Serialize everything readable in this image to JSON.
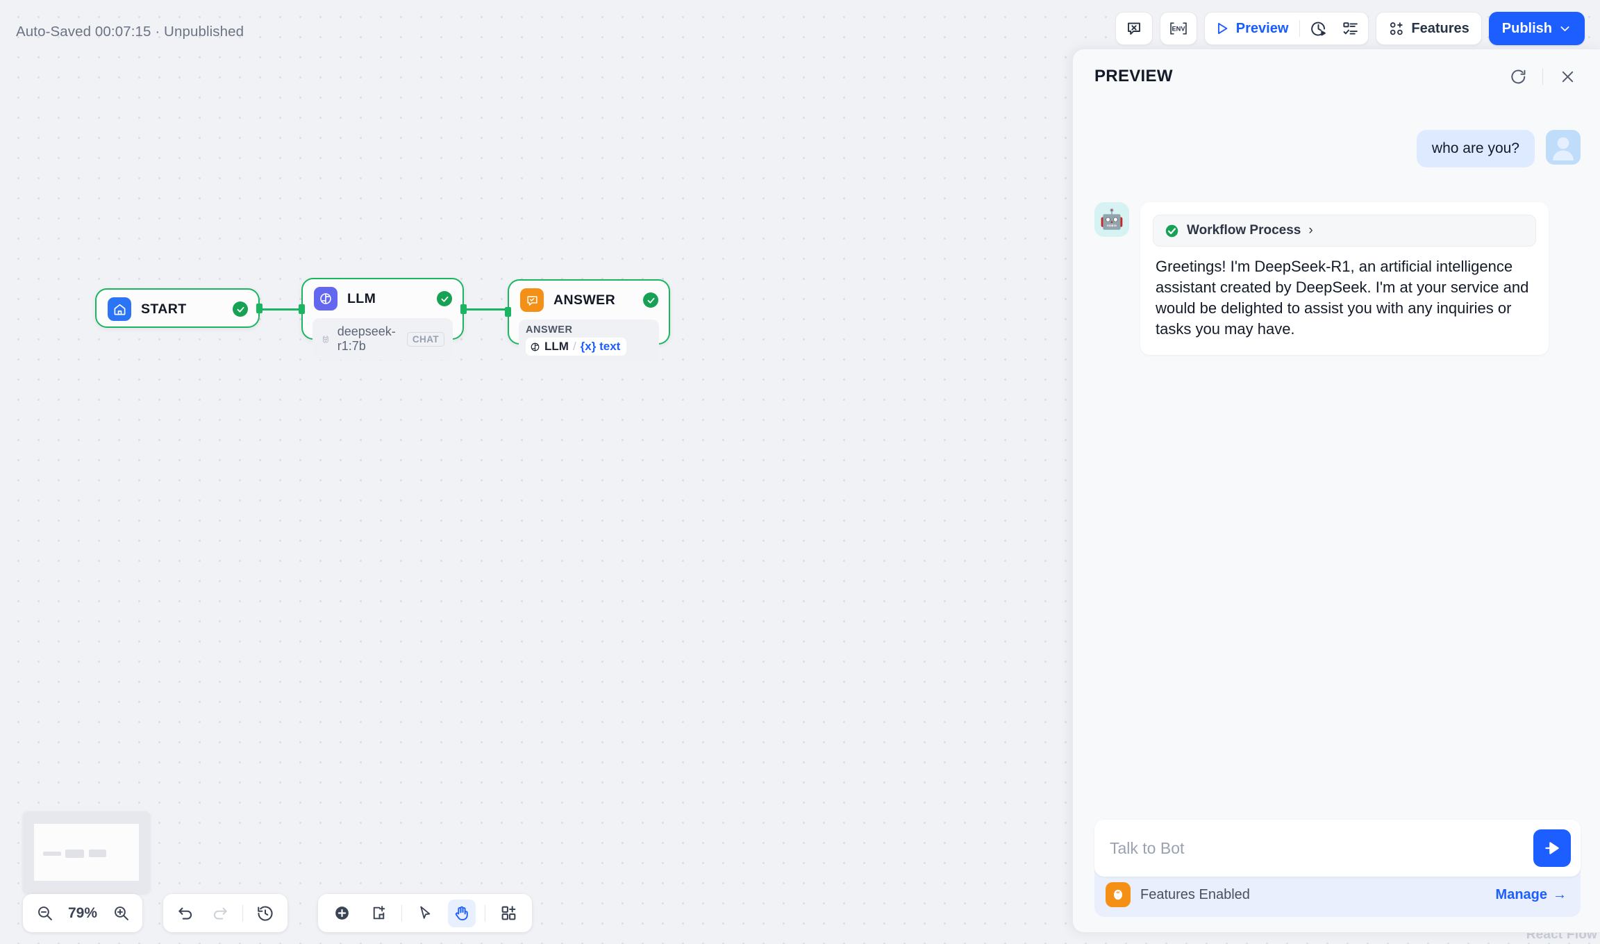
{
  "topbar": {
    "autosave_status": "Auto-Saved 00:07:15 · Unpublished",
    "icon_chat_x": "chat-variable-icon",
    "icon_env": "ENV",
    "preview_label": "Preview",
    "icon_history": "run-history-icon",
    "icon_checklist": "checklist-icon",
    "features_label": "Features",
    "publish_label": "Publish",
    "publish_caret": "⌄",
    "publish_color": "#1c5eff"
  },
  "canvas": {
    "nodes": [
      {
        "id": "start",
        "title": "START",
        "icon": "home-icon",
        "icon_color": "#2b74f5",
        "status": "success"
      },
      {
        "id": "llm",
        "title": "LLM",
        "icon": "llm-icon",
        "icon_color": "#6366ee",
        "status": "success",
        "model": "deepseek-r1:7b",
        "model_icon": "ollama-llama-icon",
        "model_tag": "CHAT"
      },
      {
        "id": "answer",
        "title": "ANSWER",
        "icon": "answer-icon",
        "icon_color": "#f59017",
        "status": "success",
        "output_label": "ANSWER",
        "variable_source": "LLM",
        "variable_sep": "/",
        "variable_name": "{x} text"
      }
    ],
    "edge_color": "#1bb561",
    "watermark": "React Flow"
  },
  "controls": {
    "zoom_out_icon": "zoom-out-icon",
    "zoom_level": "79%",
    "zoom_in_icon": "zoom-in-icon",
    "undo_icon": "undo-icon",
    "redo_icon": "redo-icon",
    "history_icon": "version-history-icon",
    "add_node_icon": "add-node-icon",
    "add_note_icon": "add-note-icon",
    "pointer_icon": "pointer-icon",
    "hand_icon": "hand-tool-icon",
    "organize_icon": "add-block-icon",
    "active_tool": "hand"
  },
  "panel": {
    "title": "PREVIEW",
    "restart_icon": "restart-icon",
    "close_icon": "close-icon",
    "messages": [
      {
        "role": "user",
        "text": "who are you?",
        "avatar": "user-avatar"
      },
      {
        "role": "bot",
        "avatar": "robot-avatar",
        "avatar_glyph": "🤖",
        "workflow_chip": "Workflow Process",
        "workflow_chip_chevron": "›",
        "workflow_status": "success",
        "text": "Greetings! I'm DeepSeek-R1, an artificial intelligence assistant created by DeepSeek. I'm at your service and would be delighted to assist you with any inquiries or tasks you may have."
      }
    ],
    "composer": {
      "input_value": "",
      "placeholder": "Talk to Bot",
      "send_icon": "send-icon",
      "features_icon": "quote-icon",
      "features_label": "Features Enabled",
      "manage_label": "Manage",
      "manage_arrow": "→"
    }
  }
}
